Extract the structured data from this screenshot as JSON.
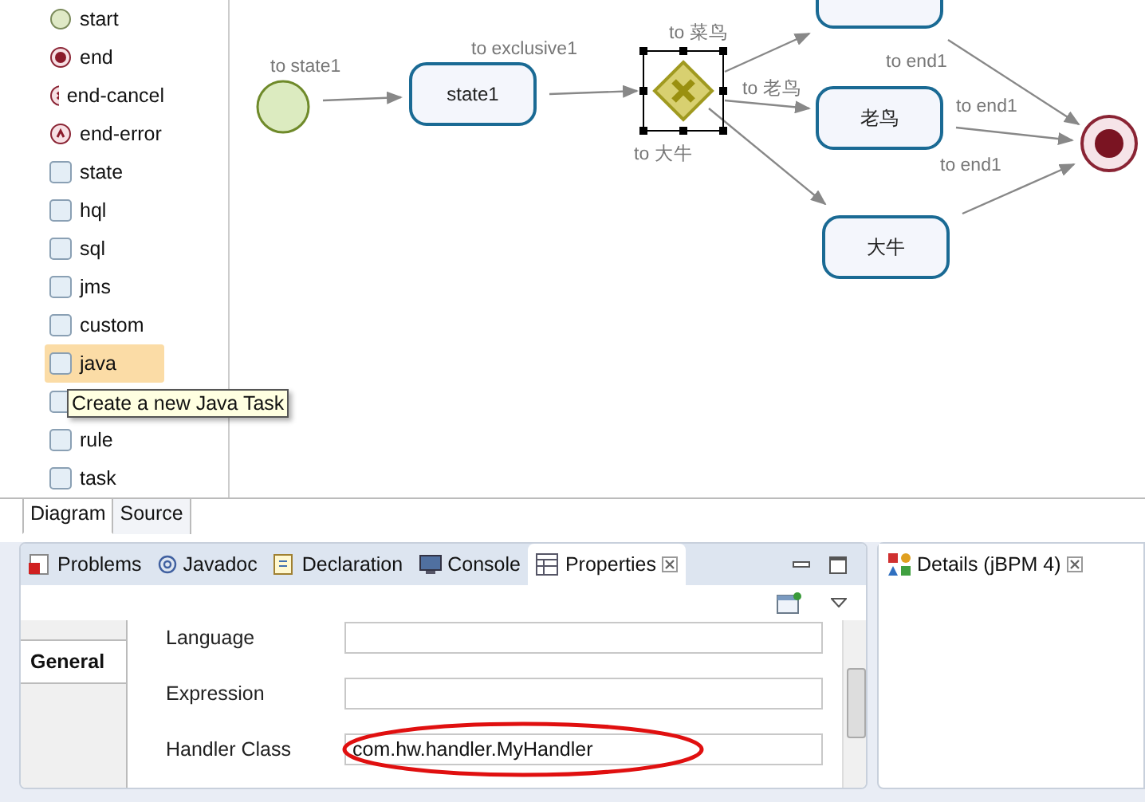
{
  "palette": {
    "items": [
      {
        "kind": "start",
        "label": "start",
        "selected": false
      },
      {
        "kind": "end",
        "label": "end",
        "selected": false
      },
      {
        "kind": "end-cancel",
        "label": "end-cancel",
        "selected": false
      },
      {
        "kind": "end-error",
        "label": "end-error",
        "selected": false
      },
      {
        "kind": "task",
        "label": "state",
        "selected": false
      },
      {
        "kind": "task",
        "label": "hql",
        "selected": false
      },
      {
        "kind": "task",
        "label": "sql",
        "selected": false
      },
      {
        "kind": "task",
        "label": "jms",
        "selected": false
      },
      {
        "kind": "task",
        "label": "custom",
        "selected": false
      },
      {
        "kind": "task",
        "label": "java",
        "selected": true
      },
      {
        "kind": "task",
        "selected": false
      },
      {
        "kind": "task",
        "label": "rule",
        "selected": false
      },
      {
        "kind": "task",
        "label": "task",
        "selected": false
      }
    ]
  },
  "tooltip": "Create a new Java Task",
  "editor_tabs": [
    {
      "label": "Diagram",
      "selected": true
    },
    {
      "label": "Source",
      "selected": false
    }
  ],
  "diagram": {
    "nodes": [
      {
        "kind": "start"
      },
      {
        "kind": "state",
        "label": "state1"
      },
      {
        "kind": "exclusive",
        "selected": true
      },
      {
        "kind": "state"
      },
      {
        "kind": "state",
        "label": "老鸟"
      },
      {
        "kind": "state",
        "label": "大牛"
      },
      {
        "kind": "end"
      }
    ],
    "transitions": [
      {
        "label": "to state1"
      },
      {
        "label": "to exclusive1"
      },
      {
        "label": "to 菜鸟"
      },
      {
        "label": "to 老鸟"
      },
      {
        "label": "to 大牛"
      },
      {
        "label": "to end1"
      },
      {
        "label": "to end1"
      },
      {
        "label": "to end1"
      }
    ]
  },
  "properties_view": {
    "tabs": [
      {
        "kind": "problems",
        "label": "Problems",
        "selected": false
      },
      {
        "kind": "javadoc",
        "label": "Javadoc",
        "selected": false
      },
      {
        "kind": "declaration",
        "label": "Declaration",
        "selected": false
      },
      {
        "kind": "console",
        "label": "Console",
        "selected": false
      },
      {
        "kind": "properties",
        "label": "Properties",
        "selected": true
      }
    ],
    "section_tabs": [
      {
        "label": "General",
        "selected": true
      }
    ],
    "fields": [
      {
        "label": "Language"
      },
      {
        "label": "Expression"
      },
      {
        "label": "Handler Class",
        "value": "com.hw.handler.MyHandler",
        "annotated": true
      }
    ]
  },
  "details_view": {
    "title": "Details (jBPM 4)"
  }
}
